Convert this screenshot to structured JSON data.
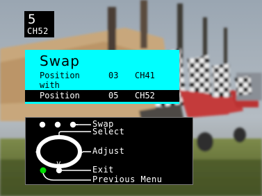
{
  "channel": {
    "number": "5",
    "label": "CH52"
  },
  "swap_menu": {
    "title": "Swap",
    "row1": {
      "label": "Position",
      "number": "03",
      "channel": "CH41"
    },
    "connector": "with",
    "row2": {
      "label": "Position",
      "number": "05",
      "channel": "CH52"
    }
  },
  "help": {
    "swap": "Swap",
    "select": "Select",
    "adjust": "Adjust",
    "exit": "Exit",
    "previous_menu": "Previous Menu"
  },
  "colors": {
    "menu_bg": "#00ffff",
    "highlight_bg": "#000000",
    "green_key": "#00dd00"
  }
}
